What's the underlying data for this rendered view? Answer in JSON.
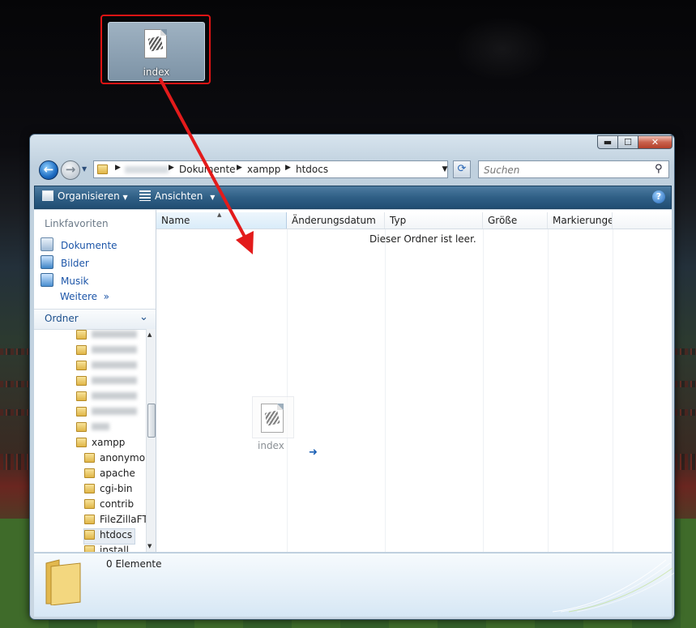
{
  "desktop": {
    "icon_label": "index"
  },
  "window": {
    "buttons": {
      "minimize": "▬",
      "maximize": "☐",
      "close": "✕"
    },
    "address": {
      "crumbs": [
        "Dokumente",
        "xampp",
        "htdocs"
      ]
    },
    "search": {
      "placeholder": "Suchen"
    },
    "toolbar": {
      "organize": "Organisieren",
      "views": "Ansichten",
      "help": "?"
    },
    "nav": {
      "favorites_title": "Linkfavoriten",
      "favorites": [
        "Dokumente",
        "Bilder",
        "Musik"
      ],
      "more": "Weitere",
      "more_glyph": "»",
      "folders_title": "Ordner",
      "tree": {
        "xampp": "xampp",
        "children": [
          "anonymous",
          "apache",
          "cgi-bin",
          "contrib",
          "FileZillaFTP",
          "htdocs",
          "install"
        ]
      }
    },
    "columns": [
      "Name",
      "Änderungsdatum",
      "Typ",
      "Größe",
      "Markierungen"
    ],
    "empty_message": "Dieser Ordner ist leer.",
    "drag_ghost_label": "index",
    "details": {
      "count": "0 Elemente"
    }
  },
  "colors": {
    "accent": "#1c55a8",
    "toolbar": "#2f5f86",
    "highlight_box": "#e01414",
    "arrow": "#e31b1b"
  }
}
